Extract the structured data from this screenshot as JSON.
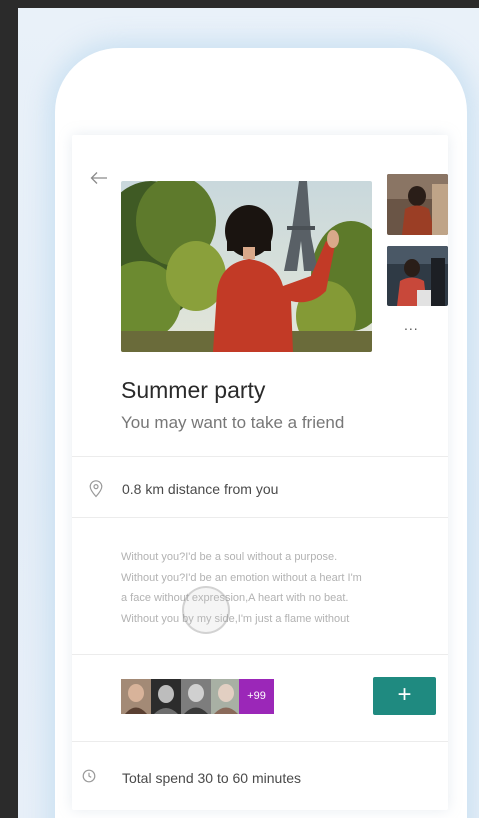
{
  "event": {
    "title": "Summer party",
    "subtitle": "You may want to take a friend"
  },
  "location": {
    "icon": "location-pin-icon",
    "text": "0.8 km distance from you"
  },
  "description": {
    "lines": [
      "Without you?I'd be a soul without a purpose.",
      "Without you?I'd be an emotion without a heart I'm",
      "a face without expression,A heart with no beat.",
      "Without you by my side,I'm just a flame without"
    ]
  },
  "attendees": {
    "more_label": "+99",
    "add_label": "+"
  },
  "duration": {
    "icon": "clock-icon",
    "text": "Total spend 30 to 60 minutes"
  },
  "gallery": {
    "more_label": "..."
  },
  "colors": {
    "accent": "#1f8a80",
    "badge": "#9b27b8",
    "background": "#e9f1f9"
  }
}
